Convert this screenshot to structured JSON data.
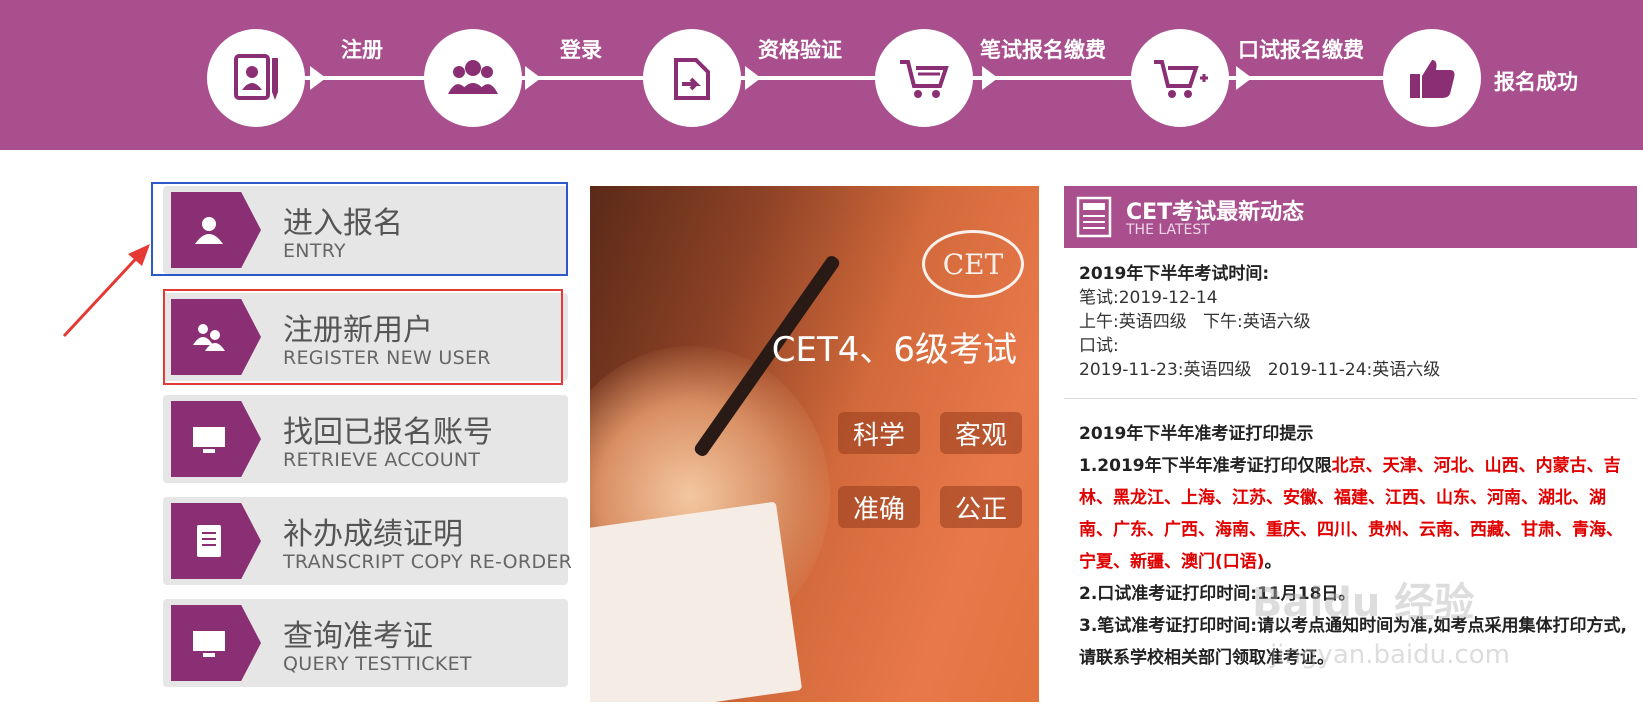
{
  "steps": [
    {
      "label": "注册",
      "icon": "register-card-icon"
    },
    {
      "label": "登录",
      "icon": "users-group-icon"
    },
    {
      "label": "资格验证",
      "icon": "verify-doc-icon"
    },
    {
      "label": "笔试报名缴费",
      "icon": "cart-icon"
    },
    {
      "label": "口试报名缴费",
      "icon": "cart-plus-icon"
    },
    {
      "label": "报名成功",
      "icon": "thumbs-up-icon"
    }
  ],
  "menu": [
    {
      "cn": "进入报名",
      "en": "ENTRY",
      "icon": "user-icon"
    },
    {
      "cn": "注册新用户",
      "en": "REGISTER NEW USER",
      "icon": "users-icon"
    },
    {
      "cn": "找回已报名账号",
      "en": "RETRIEVE ACCOUNT",
      "icon": "monitor-icon"
    },
    {
      "cn": "补办成绩证明",
      "en": "TRANSCRIPT COPY RE-ORDER",
      "icon": "document-icon"
    },
    {
      "cn": "查询准考证",
      "en": "QUERY TESTTICKET",
      "icon": "monitor-icon"
    }
  ],
  "hero": {
    "logo": "CET",
    "title": "CET4、6级考试",
    "tags": [
      "科学",
      "客观",
      "准确",
      "公正"
    ]
  },
  "news": {
    "title": "CET考试最新动态",
    "subtitle": "THE LATEST",
    "exam_heading": "2019年下半年考试时间:",
    "written_label": "笔试:",
    "written_date": "2019-12-14",
    "am_label": "上午:",
    "am_value": "英语四级",
    "pm_label": "下午:",
    "pm_value": "英语六级",
    "oral_label": "口试:",
    "oral_date1": "2019-11-23:",
    "oral_value1": "英语四级",
    "oral_date2": "2019-11-24:",
    "oral_value2": "英语六级",
    "print_heading": "2019年下半年准考证打印提示",
    "tip1_prefix": "1.2019年下半年准考证打印仅限",
    "tip1_regions": "北京、天津、河北、山西、内蒙古、吉林、黑龙江、上海、江苏、安徽、福建、江西、山东、河南、湖北、湖南、广东、广西、海南、重庆、四川、贵州、云南、西藏、甘肃、青海、宁夏、新疆、澳门(口语)",
    "tip1_suffix": "。",
    "tip2": "2.口试准考证打印时间:11月18日。",
    "tip3": "3.笔试准考证打印时间:请以考点通知时间为准,如考点采用集体打印方式,请联系学校相关部门领取准考证。"
  },
  "watermark": {
    "line1": "Baidu 经验",
    "line2": "jingyan.baidu.com"
  },
  "colors": {
    "brand": "#a94f8e",
    "icon_bg": "#8a2f74",
    "highlight_blue": "#2d58c7",
    "highlight_red": "#e53935",
    "alert_red": "#e00000"
  }
}
